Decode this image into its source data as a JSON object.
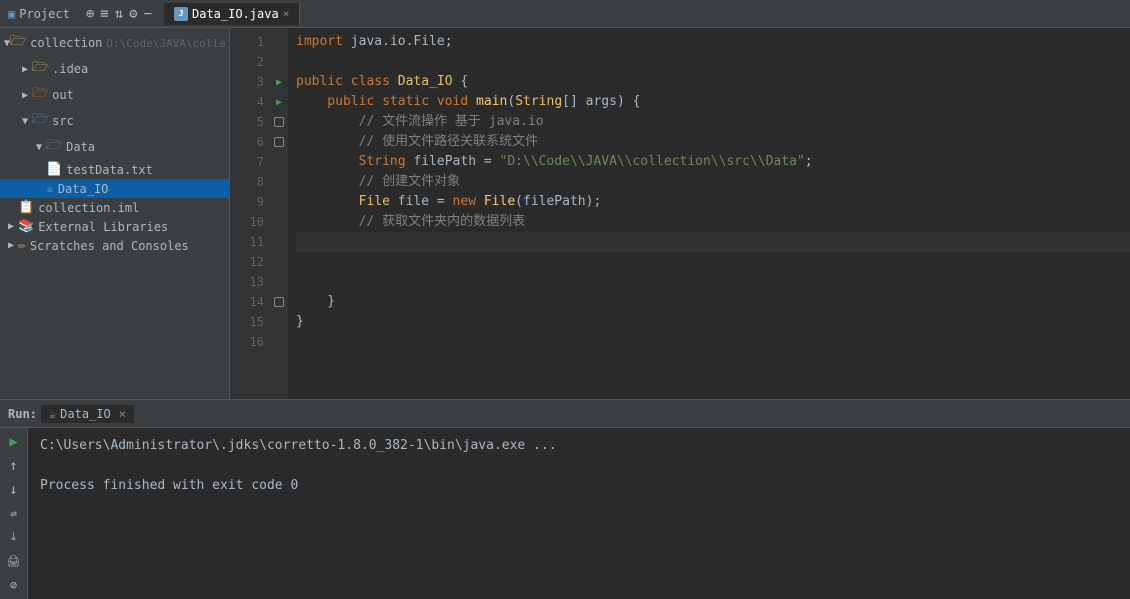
{
  "titleBar": {
    "projectLabel": "Project",
    "tabLabel": "Data_IO.java"
  },
  "sidebar": {
    "items": [
      {
        "id": "collection",
        "label": "collection",
        "indent": 0,
        "type": "root",
        "expanded": true,
        "path": "D:\\Code\\JAVA\\colle"
      },
      {
        "id": "idea",
        "label": ".idea",
        "indent": 1,
        "type": "folder",
        "expanded": false
      },
      {
        "id": "out",
        "label": "out",
        "indent": 1,
        "type": "folder-orange",
        "expanded": false
      },
      {
        "id": "src",
        "label": "src",
        "indent": 1,
        "type": "folder",
        "expanded": true
      },
      {
        "id": "data-folder",
        "label": "Data",
        "indent": 2,
        "type": "folder",
        "expanded": true
      },
      {
        "id": "testData",
        "label": "testData.txt",
        "indent": 3,
        "type": "file-txt"
      },
      {
        "id": "data-io",
        "label": "Data_IO",
        "indent": 3,
        "type": "file-java",
        "selected": true
      },
      {
        "id": "collection-iml",
        "label": "collection.iml",
        "indent": 1,
        "type": "file-iml"
      },
      {
        "id": "ext-libs",
        "label": "External Libraries",
        "indent": 0,
        "type": "ext-lib",
        "expanded": false
      },
      {
        "id": "scratches",
        "label": "Scratches and Consoles",
        "indent": 0,
        "type": "scratches",
        "expanded": false
      }
    ]
  },
  "editor": {
    "lines": [
      {
        "num": 1,
        "content": "import java.io.File;",
        "tokens": [
          {
            "t": "kw",
            "v": "import"
          },
          {
            "t": "var",
            "v": " java.io.File;"
          }
        ]
      },
      {
        "num": 2,
        "content": "",
        "tokens": []
      },
      {
        "num": 3,
        "content": "public class Data_IO {",
        "tokens": [
          {
            "t": "kw",
            "v": "public"
          },
          {
            "t": "var",
            "v": " "
          },
          {
            "t": "kw",
            "v": "class"
          },
          {
            "t": "var",
            "v": " "
          },
          {
            "t": "cls",
            "v": "Data_IO"
          },
          {
            "t": "var",
            "v": " {"
          }
        ],
        "hasArrow": true
      },
      {
        "num": 4,
        "content": "    public static void main(String[] args) {",
        "tokens": [
          {
            "t": "kw",
            "v": "    public"
          },
          {
            "t": "var",
            "v": " "
          },
          {
            "t": "kw",
            "v": "static"
          },
          {
            "t": "var",
            "v": " "
          },
          {
            "t": "kw",
            "v": "void"
          },
          {
            "t": "var",
            "v": " "
          },
          {
            "t": "fn",
            "v": "main"
          },
          {
            "t": "var",
            "v": "("
          },
          {
            "t": "cls",
            "v": "String"
          },
          {
            "t": "var",
            "v": "[] args) {"
          }
        ],
        "hasArrow": true
      },
      {
        "num": 5,
        "content": "        // 文件流操作 基于 java.io",
        "tokens": [
          {
            "t": "comment",
            "v": "        // 文件流操作 基于 java.io"
          }
        ],
        "hasBreak": true
      },
      {
        "num": 6,
        "content": "        // 使用文件路径关联系统文件",
        "tokens": [
          {
            "t": "comment",
            "v": "        // 使用文件路径关联系统文件"
          }
        ],
        "hasBreak": true
      },
      {
        "num": 7,
        "content": "        String filePath = \"D:\\\\Code\\\\JAVA\\\\collection\\\\src\\\\Data\";",
        "tokens": [
          {
            "t": "kw",
            "v": "        String"
          },
          {
            "t": "var",
            "v": " filePath = "
          },
          {
            "t": "str",
            "v": "\"D:\\\\Code\\\\JAVA\\\\collection\\\\src\\\\Data\""
          },
          {
            "t": "var",
            "v": ";"
          }
        ]
      },
      {
        "num": 8,
        "content": "        // 创建文件对象",
        "tokens": [
          {
            "t": "comment",
            "v": "        // 创建文件对象"
          }
        ]
      },
      {
        "num": 9,
        "content": "        File file = new File(filePath);",
        "tokens": [
          {
            "t": "cls",
            "v": "        File"
          },
          {
            "t": "var",
            "v": " file = "
          },
          {
            "t": "kw",
            "v": "new"
          },
          {
            "t": "var",
            "v": " "
          },
          {
            "t": "fn",
            "v": "File"
          },
          {
            "t": "var",
            "v": "(filePath);"
          }
        ]
      },
      {
        "num": 10,
        "content": "        // 获取文件夹内的数据列表",
        "tokens": [
          {
            "t": "comment",
            "v": "        // 获取文件夹内的数据列表"
          }
        ]
      },
      {
        "num": 11,
        "content": "",
        "tokens": [],
        "isActive": true
      },
      {
        "num": 12,
        "content": "",
        "tokens": []
      },
      {
        "num": 13,
        "content": "",
        "tokens": []
      },
      {
        "num": 14,
        "content": "    }",
        "tokens": [
          {
            "t": "var",
            "v": "    }"
          }
        ],
        "hasBreak": true
      },
      {
        "num": 15,
        "content": "}",
        "tokens": [
          {
            "t": "var",
            "v": "}"
          }
        ]
      },
      {
        "num": 16,
        "content": "",
        "tokens": []
      }
    ]
  },
  "bottomPanel": {
    "runLabel": "Run:",
    "tabLabel": "Data_IO",
    "outputLines": [
      {
        "text": "C:\\Users\\Administrator\\.jdks\\corretto-1.8.0_382-1\\bin\\java.exe ...",
        "type": "path"
      },
      {
        "text": "",
        "type": "blank"
      },
      {
        "text": "Process finished with exit code 0",
        "type": "exit"
      }
    ]
  },
  "icons": {
    "play": "▶",
    "stop": "■",
    "rerun": "↺",
    "build": "⚙",
    "arrow_right": "▶",
    "arrow_down": "▼",
    "folder": "📁",
    "close": "×"
  }
}
